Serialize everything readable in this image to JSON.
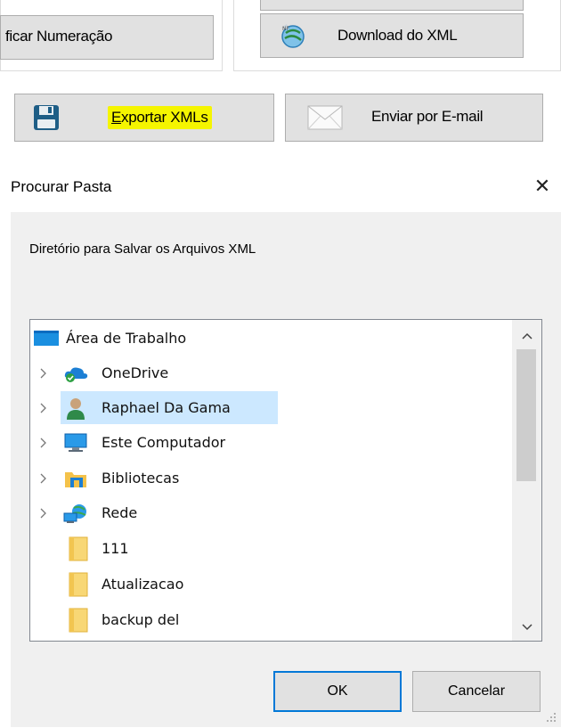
{
  "toolbar": {
    "verificar_label": "ficar Numeração",
    "download_label": "Download do XML",
    "export_label_first": "E",
    "export_label_rest": "xportar XMLs",
    "email_label": "Enviar por E-mail"
  },
  "dialog": {
    "title": "Procurar Pasta",
    "prompt": "Diretório para Salvar os Arquivos XML",
    "ok_label": "OK",
    "cancel_label": "Cancelar"
  },
  "tree": {
    "items": [
      {
        "label": "Área de Trabalho",
        "icon": "desktop-icon"
      },
      {
        "label": "OneDrive",
        "icon": "onedrive-icon"
      },
      {
        "label": "Raphael Da Gama",
        "icon": "user-folder-icon"
      },
      {
        "label": "Este Computador",
        "icon": "computer-icon"
      },
      {
        "label": "Bibliotecas",
        "icon": "libraries-icon"
      },
      {
        "label": "Rede",
        "icon": "network-icon"
      },
      {
        "label": "111",
        "icon": "folder-icon"
      },
      {
        "label": "Atualizacao",
        "icon": "folder-icon"
      },
      {
        "label": "backup del",
        "icon": "folder-icon"
      }
    ],
    "selected": "Raphael Da Gama"
  },
  "colors": {
    "selection": "#cce8ff",
    "highlight": "#f5f500",
    "dialog_bg": "#f0f0f0",
    "accent": "#0078d7"
  }
}
